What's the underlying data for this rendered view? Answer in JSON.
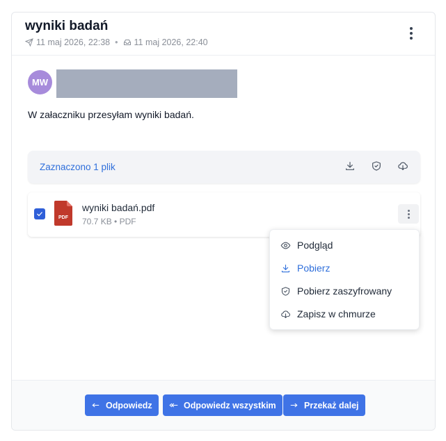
{
  "email": {
    "subject": "wyniki badań",
    "sent_date": "11 maj 2026, 22:38",
    "received_date": "11 maj 2026, 22:40",
    "sender_initials": "MW",
    "body": "W załaczniku przesyłam wyniki badań."
  },
  "attachments_bar": {
    "selected_label": "Zaznaczono 1 plik",
    "icons": [
      "download-icon",
      "shield-icon",
      "cloud-download-icon"
    ]
  },
  "file": {
    "name": "wyniki badań.pdf",
    "meta": "70.7 KB • PDF",
    "type_badge": "PDF",
    "checked": true
  },
  "context_menu": {
    "items": [
      {
        "label": "Podgląd",
        "icon": "eye-icon",
        "active": false
      },
      {
        "label": "Pobierz",
        "icon": "download-icon",
        "active": true
      },
      {
        "label": "Pobierz zaszyfrowany",
        "icon": "shield-icon",
        "active": false
      },
      {
        "label": "Zapisz w chmurze",
        "icon": "cloud-download-icon",
        "active": false
      }
    ]
  },
  "footer": {
    "reply": "Odpowiedz",
    "reply_all": "Odpowiedz wszystkim",
    "forward": "Przekaż dalej"
  },
  "colors": {
    "accent": "#3f73e6",
    "link": "#2f6fdb",
    "avatar": "#a78bdb",
    "pdf": "#c0392b"
  }
}
